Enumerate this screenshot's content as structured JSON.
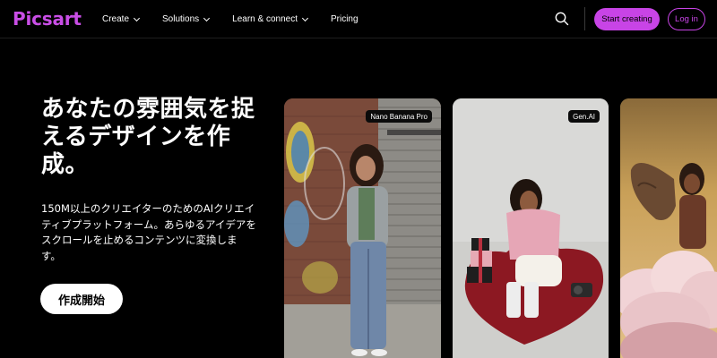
{
  "header": {
    "logo": "Picsart",
    "nav": [
      {
        "label": "Create",
        "has_dropdown": true
      },
      {
        "label": "Solutions",
        "has_dropdown": true
      },
      {
        "label": "Learn & connect",
        "has_dropdown": true
      },
      {
        "label": "Pricing",
        "has_dropdown": false
      }
    ],
    "search_icon": "search-icon",
    "start_label": "Start creating",
    "login_label": "Log in"
  },
  "hero": {
    "title": "あなたの雰囲気を捉えるデザインを作成。",
    "description": "150M以上のクリエイターのためのAIクリエイティブプラットフォーム。あらゆるアイデアをスクロールを止めるコンテンツに変換します。",
    "cta_label": "作成開始"
  },
  "cards": [
    {
      "badge": "Nano Banana Pro"
    },
    {
      "badge": "Gen.AI"
    },
    {
      "badge": ""
    }
  ],
  "colors": {
    "brand": "#c844e6",
    "background": "#000000"
  }
}
